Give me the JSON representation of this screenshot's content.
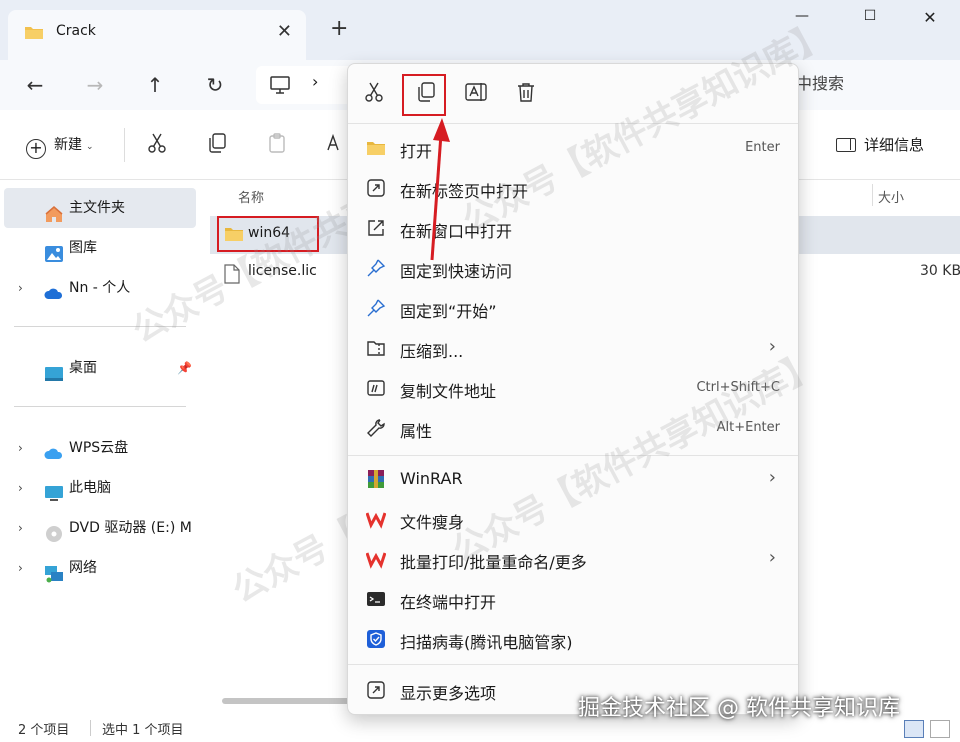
{
  "window": {
    "tab_title": "Crack",
    "tab_close": "✕",
    "new_tab": "+",
    "minimize": "—",
    "maximize": "☐",
    "close": "✕"
  },
  "address": {
    "separator": "›",
    "search_fragment": "中搜索"
  },
  "toolbar": {
    "new_label": "新建",
    "new_dropdown": "⌄",
    "details_label": "详细信息"
  },
  "sidebar": {
    "items": [
      {
        "label": "主文件夹",
        "icon": "home-icon"
      },
      {
        "label": "图库",
        "icon": "gallery-icon"
      },
      {
        "label": "Nn - 个人",
        "icon": "onedrive-cloud-icon",
        "chevron": "›"
      },
      {
        "label": "桌面",
        "icon": "desktop-icon",
        "pin": "📌"
      },
      {
        "label": "WPS云盘",
        "icon": "wps-cloud-icon",
        "chevron": "›"
      },
      {
        "label": "此电脑",
        "icon": "this-pc-icon",
        "chevron": "›"
      },
      {
        "label": "DVD 驱动器 (E:) M",
        "icon": "dvd-drive-icon",
        "chevron": "›"
      },
      {
        "label": "网络",
        "icon": "network-icon",
        "chevron": "›"
      }
    ]
  },
  "filelist": {
    "columns": {
      "name": "名称",
      "size": "大小"
    },
    "rows": [
      {
        "name": "win64",
        "size": "",
        "type": "folder",
        "selected": true
      },
      {
        "name": "license.lic",
        "size": "30 KB",
        "type": "file",
        "selected": false
      }
    ]
  },
  "status": {
    "count": "2 个项目",
    "selected": "选中 1 个项目"
  },
  "context_menu": {
    "quick_actions": [
      {
        "name": "cut",
        "icon": "scissors-icon"
      },
      {
        "name": "copy",
        "icon": "copy-icon"
      },
      {
        "name": "rename",
        "icon": "rename-icon"
      },
      {
        "name": "delete",
        "icon": "trash-icon"
      }
    ],
    "items": [
      {
        "label": "打开",
        "shortcut": "Enter",
        "icon": "folder-icon"
      },
      {
        "label": "在新标签页中打开",
        "shortcut": "",
        "icon": "open-new-tab-icon"
      },
      {
        "label": "在新窗口中打开",
        "shortcut": "",
        "icon": "open-new-window-icon"
      },
      {
        "label": "固定到快速访问",
        "shortcut": "",
        "icon": "pin-icon"
      },
      {
        "label": "固定到“开始”",
        "shortcut": "",
        "icon": "pin-start-icon"
      },
      {
        "label": "压缩到...",
        "shortcut": "",
        "icon": "zip-icon",
        "submenu": "›"
      },
      {
        "label": "复制文件地址",
        "shortcut": "Ctrl+Shift+C",
        "icon": "copy-path-icon"
      },
      {
        "label": "属性",
        "shortcut": "Alt+Enter",
        "icon": "wrench-icon"
      },
      {
        "label": "WinRAR",
        "shortcut": "",
        "icon": "winrar-icon",
        "submenu": "›"
      },
      {
        "label": "文件瘦身",
        "shortcut": "",
        "icon": "wps-icon"
      },
      {
        "label": "批量打印/批量重命名/更多",
        "shortcut": "",
        "icon": "wps-icon",
        "submenu": "›"
      },
      {
        "label": "在终端中打开",
        "shortcut": "",
        "icon": "terminal-icon"
      },
      {
        "label": "扫描病毒(腾讯电脑管家)",
        "shortcut": "",
        "icon": "tencent-shield-icon"
      },
      {
        "label": "显示更多选项",
        "shortcut": "",
        "icon": "more-options-icon"
      }
    ]
  },
  "watermark": {
    "text": "公众号【软件共享知识库】",
    "credit": "掘金技术社区 @ 软件共享知识库"
  },
  "colors": {
    "highlight_red": "#d61c22",
    "folder_yellow": "#f2c14e",
    "selection": "#e1e6ed"
  }
}
